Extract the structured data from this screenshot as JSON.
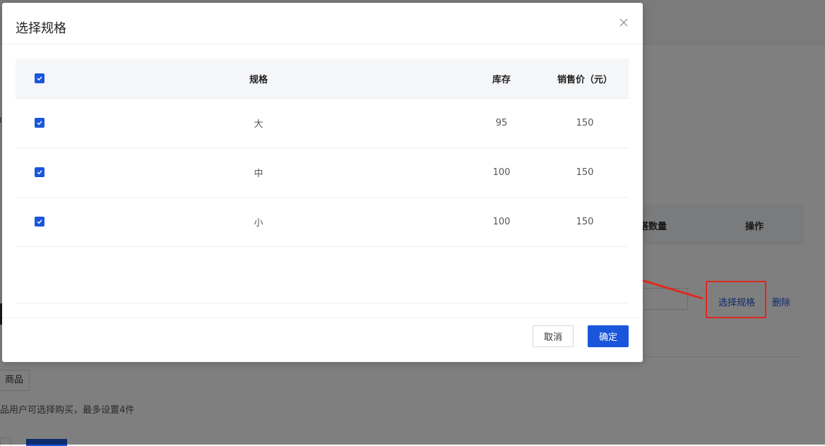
{
  "background_page": {
    "table_headers": {
      "quantity": "搭数量",
      "actions": "操作"
    },
    "row_actions": {
      "select_spec": "选择规格",
      "delete": "删除"
    },
    "add_product_button": "商品",
    "hint": "品用户可选择购买，最多设置4件"
  },
  "modal": {
    "title": "选择规格",
    "columns": {
      "spec": "规格",
      "stock": "库存",
      "price": "销售价（元）"
    },
    "header_checked": true,
    "rows": [
      {
        "checked": true,
        "spec": "大",
        "stock": "95",
        "price": "150"
      },
      {
        "checked": true,
        "spec": "中",
        "stock": "100",
        "price": "150"
      },
      {
        "checked": true,
        "spec": "小",
        "stock": "100",
        "price": "150"
      }
    ],
    "buttons": {
      "cancel": "取消",
      "confirm": "确定"
    }
  },
  "colors": {
    "primary": "#1a56db",
    "annotation": "#e0281f"
  },
  "icons": {
    "close": "close-icon",
    "check": "check-icon"
  }
}
